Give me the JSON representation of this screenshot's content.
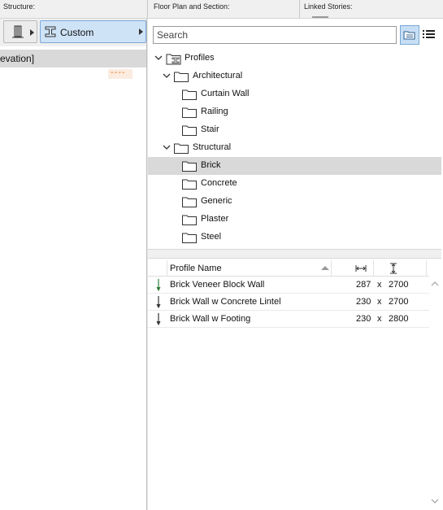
{
  "header": {
    "structure_label": "Structure:",
    "floor_plan_label": "Floor Plan and Section:",
    "linked_stories_label": "Linked Stories:"
  },
  "left_panel": {
    "custom_button_label": "Custom",
    "elevation_row_text": "evation]",
    "line_sample": "----"
  },
  "search": {
    "placeholder": "Search",
    "value": ""
  },
  "tree": {
    "root": "Profiles",
    "groups": [
      {
        "label": "Architectural",
        "expanded": true,
        "children": [
          "Curtain Wall",
          "Railing",
          "Stair"
        ]
      },
      {
        "label": "Structural",
        "expanded": true,
        "children": [
          "Brick",
          "Concrete",
          "Generic",
          "Plaster",
          "Steel"
        ]
      }
    ],
    "selected": "Brick"
  },
  "table": {
    "columns": [
      "Profile Name",
      "width-icon",
      "height-icon"
    ],
    "rows": [
      {
        "name": "Brick Veneer Block Wall",
        "width": "287",
        "sep": "x",
        "height": "2700",
        "icon_color": "#2e7d32"
      },
      {
        "name": "Brick Wall w Concrete Lintel",
        "width": "230",
        "sep": "x",
        "height": "2700",
        "icon_color": "#333333"
      },
      {
        "name": "Brick Wall w Footing",
        "width": "230",
        "sep": "x",
        "height": "2800",
        "icon_color": "#333333"
      }
    ]
  },
  "colors": {
    "selection": "#d9d9d9",
    "button_active": "#cfe3f7",
    "accent_border": "#7aa8d8",
    "line_sample": "#e67e22"
  }
}
